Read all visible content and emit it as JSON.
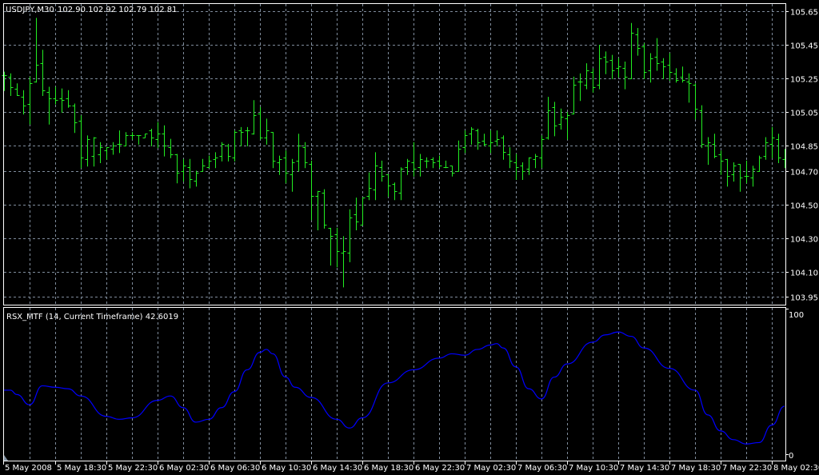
{
  "main_panel": {
    "symbol_label": "USDJPY,M30",
    "ohlc_readout": "102.90 102.92 102.79 102.81",
    "price_axis_labels": [
      "105.65",
      "105.45",
      "105.25",
      "105.05",
      "104.85",
      "104.70",
      "104.50",
      "104.30",
      "104.10",
      "103.95"
    ]
  },
  "indicator_panel": {
    "title": "RSX_MTF (14, Current Timeframe) 42.6019",
    "axis_max_label": "100",
    "axis_min_label": "0"
  },
  "time_axis_labels": [
    "5 May 2008",
    "5 May 18:30",
    "5 May 22:30",
    "6 May 02:30",
    "6 May 06:30",
    "6 May 10:30",
    "6 May 14:30",
    "6 May 18:30",
    "6 May 22:30",
    "7 May 02:30",
    "7 May 06:30",
    "7 May 10:30",
    "7 May 14:30",
    "7 May 18:30",
    "7 May 22:30",
    "8 May 02:30"
  ],
  "colors": {
    "background": "#000000",
    "bars": "#22ee22",
    "grid": "#7f8c9c",
    "rsx_line": "#0000ff",
    "frame": "#ffffff"
  },
  "chart_data": [
    {
      "type": "ohlc",
      "title": "USDJPY,M30",
      "ylim": [
        103.95,
        105.65
      ],
      "price_ticks": [
        105.65,
        105.45,
        105.25,
        105.05,
        104.85,
        104.7,
        104.5,
        104.3,
        104.1,
        103.95
      ],
      "bars_ohlc": [
        [
          105.27,
          105.29,
          105.18,
          105.27
        ],
        [
          105.26,
          105.28,
          105.15,
          105.2
        ],
        [
          105.19,
          105.22,
          105.15,
          105.15
        ],
        [
          105.14,
          105.18,
          105.04,
          105.09
        ],
        [
          105.1,
          105.26,
          104.98,
          105.22
        ],
        [
          105.23,
          105.61,
          105.23,
          105.33
        ],
        [
          105.34,
          105.42,
          105.15,
          105.18
        ],
        [
          105.17,
          105.2,
          104.98,
          105.13
        ],
        [
          105.13,
          105.2,
          105.1,
          105.12
        ],
        [
          105.13,
          105.19,
          105.05,
          105.12
        ],
        [
          105.13,
          105.18,
          105.08,
          105.09
        ],
        [
          105.09,
          105.1,
          104.93,
          104.99
        ],
        [
          105.0,
          105.03,
          104.72,
          104.78
        ],
        [
          104.77,
          104.91,
          104.73,
          104.89
        ],
        [
          104.79,
          104.9,
          104.73,
          104.9
        ],
        [
          104.8,
          104.87,
          104.75,
          104.84
        ],
        [
          104.82,
          104.84,
          104.77,
          104.84
        ],
        [
          104.83,
          104.87,
          104.8,
          104.85
        ],
        [
          104.86,
          104.94,
          104.81,
          104.86
        ],
        [
          104.85,
          104.93,
          104.85,
          104.91
        ],
        [
          104.91,
          104.93,
          104.89,
          104.91
        ],
        [
          104.91,
          104.91,
          104.86,
          104.91
        ],
        [
          104.9,
          104.92,
          104.9,
          104.92
        ],
        [
          104.94,
          104.95,
          104.85,
          104.9
        ],
        [
          104.89,
          104.99,
          104.84,
          104.92
        ],
        [
          104.92,
          104.97,
          104.79,
          104.85
        ],
        [
          104.84,
          104.89,
          104.78,
          104.8
        ],
        [
          104.8,
          104.8,
          104.63,
          104.69
        ],
        [
          104.7,
          104.77,
          104.64,
          104.73
        ],
        [
          104.72,
          104.77,
          104.6,
          104.65
        ],
        [
          104.64,
          104.7,
          104.61,
          104.69
        ],
        [
          104.7,
          104.77,
          104.7,
          104.73
        ],
        [
          104.72,
          104.79,
          104.72,
          104.76
        ],
        [
          104.77,
          104.81,
          104.72,
          104.78
        ],
        [
          104.79,
          104.87,
          104.76,
          104.86
        ],
        [
          104.85,
          104.86,
          104.76,
          104.79
        ],
        [
          104.78,
          104.94,
          104.76,
          104.93
        ],
        [
          104.94,
          104.96,
          104.85,
          104.93
        ],
        [
          104.94,
          104.96,
          104.85,
          104.94
        ],
        [
          104.92,
          105.12,
          104.92,
          105.03
        ],
        [
          105.04,
          105.08,
          104.89,
          104.9
        ],
        [
          104.9,
          105.01,
          104.86,
          104.94
        ],
        [
          104.93,
          104.93,
          104.72,
          104.76
        ],
        [
          104.75,
          104.79,
          104.68,
          104.77
        ],
        [
          104.78,
          104.82,
          104.63,
          104.69
        ],
        [
          104.68,
          104.77,
          104.58,
          104.75
        ],
        [
          104.76,
          104.92,
          104.7,
          104.85
        ],
        [
          104.84,
          104.87,
          104.72,
          104.75
        ],
        [
          104.74,
          104.76,
          104.41,
          104.55
        ],
        [
          104.55,
          104.58,
          104.35,
          104.58
        ],
        [
          104.57,
          104.59,
          104.36,
          104.38
        ],
        [
          104.36,
          104.36,
          104.14,
          104.31
        ],
        [
          104.32,
          104.36,
          104.13,
          104.22
        ],
        [
          104.21,
          104.31,
          104.01,
          104.22
        ],
        [
          104.21,
          104.47,
          104.16,
          104.42
        ],
        [
          104.44,
          104.54,
          104.35,
          104.4
        ],
        [
          104.38,
          104.54,
          104.38,
          104.54
        ],
        [
          104.55,
          104.69,
          104.53,
          104.6
        ],
        [
          104.59,
          104.81,
          104.53,
          104.73
        ],
        [
          104.72,
          104.76,
          104.64,
          104.67
        ],
        [
          104.68,
          104.68,
          104.55,
          104.61
        ],
        [
          104.62,
          104.63,
          104.53,
          104.58
        ],
        [
          104.57,
          104.72,
          104.53,
          104.71
        ],
        [
          104.72,
          104.77,
          104.68,
          104.76
        ],
        [
          104.75,
          104.87,
          104.67,
          104.71
        ],
        [
          104.72,
          104.8,
          104.67,
          104.77
        ],
        [
          104.76,
          104.78,
          104.72,
          104.76
        ],
        [
          104.77,
          104.78,
          104.72,
          104.75
        ],
        [
          104.76,
          104.79,
          104.72,
          104.73
        ],
        [
          104.72,
          104.76,
          104.72,
          104.72
        ],
        [
          104.73,
          104.73,
          104.67,
          104.69
        ],
        [
          104.7,
          104.88,
          104.7,
          104.83
        ],
        [
          104.84,
          104.94,
          104.81,
          104.91
        ],
        [
          104.92,
          104.96,
          104.86,
          104.95
        ],
        [
          104.94,
          104.95,
          104.83,
          104.87
        ],
        [
          104.88,
          104.92,
          104.85,
          104.86
        ],
        [
          104.85,
          104.94,
          104.81,
          104.87
        ],
        [
          104.88,
          104.94,
          104.85,
          104.89
        ],
        [
          104.9,
          104.91,
          104.77,
          104.81
        ],
        [
          104.8,
          104.84,
          104.72,
          104.76
        ],
        [
          104.75,
          104.8,
          104.65,
          104.72
        ],
        [
          104.73,
          104.75,
          104.65,
          104.7
        ],
        [
          104.71,
          104.78,
          104.68,
          104.78
        ],
        [
          104.77,
          104.8,
          104.72,
          104.79
        ],
        [
          104.78,
          104.91,
          104.72,
          104.89
        ],
        [
          104.9,
          105.14,
          104.89,
          105.06
        ],
        [
          105.08,
          105.11,
          104.91,
          104.97
        ],
        [
          104.98,
          105.07,
          104.95,
          105.02
        ],
        [
          105.01,
          105.05,
          104.89,
          105.03
        ],
        [
          105.04,
          105.26,
          105.04,
          105.21
        ],
        [
          105.23,
          105.28,
          105.12,
          105.23
        ],
        [
          105.21,
          105.34,
          105.19,
          105.3
        ],
        [
          105.29,
          105.31,
          105.17,
          105.2
        ],
        [
          105.21,
          105.45,
          105.19,
          105.37
        ],
        [
          105.38,
          105.41,
          105.28,
          105.35
        ],
        [
          105.36,
          105.39,
          105.25,
          105.3
        ],
        [
          105.31,
          105.37,
          105.26,
          105.32
        ],
        [
          105.31,
          105.35,
          105.19,
          105.26
        ],
        [
          105.25,
          105.58,
          105.25,
          105.52
        ],
        [
          105.51,
          105.55,
          105.39,
          105.43
        ],
        [
          105.44,
          105.46,
          105.25,
          105.29
        ],
        [
          105.3,
          105.4,
          105.23,
          105.37
        ],
        [
          105.38,
          105.49,
          105.3,
          105.34
        ],
        [
          105.35,
          105.37,
          105.25,
          105.32
        ],
        [
          105.33,
          105.4,
          105.24,
          105.29
        ],
        [
          105.28,
          105.31,
          105.23,
          105.24
        ],
        [
          105.26,
          105.32,
          105.23,
          105.24
        ],
        [
          105.23,
          105.28,
          105.11,
          105.22
        ],
        [
          105.21,
          105.22,
          105.01,
          105.07
        ],
        [
          105.06,
          105.09,
          104.84,
          104.86
        ],
        [
          104.85,
          104.9,
          104.74,
          104.87
        ],
        [
          104.86,
          104.92,
          104.78,
          104.79
        ],
        [
          104.8,
          104.82,
          104.68,
          104.76
        ],
        [
          104.77,
          104.77,
          104.61,
          104.67
        ],
        [
          104.68,
          104.75,
          104.64,
          104.73
        ],
        [
          104.74,
          104.74,
          104.58,
          104.66
        ],
        [
          104.67,
          104.76,
          104.63,
          104.67
        ],
        [
          104.66,
          104.73,
          104.61,
          104.71
        ],
        [
          104.7,
          104.79,
          104.7,
          104.78
        ],
        [
          104.79,
          104.9,
          104.77,
          104.87
        ],
        [
          104.86,
          104.96,
          104.78,
          104.9
        ],
        [
          104.89,
          104.92,
          104.75,
          104.78
        ],
        [
          104.77,
          104.83,
          104.72,
          104.79
        ]
      ]
    },
    {
      "type": "line",
      "title": "RSX_MTF (14, Current Timeframe) 42.6019",
      "ylim": [
        0,
        100
      ],
      "series": [
        {
          "name": "RSX_MTF",
          "points_bar_index_value": [
            [
              0,
              44
            ],
            [
              1,
              44
            ],
            [
              2,
              41
            ],
            [
              4,
              34
            ],
            [
              6,
              47
            ],
            [
              8,
              46
            ],
            [
              10,
              45
            ],
            [
              12,
              40
            ],
            [
              16,
              26
            ],
            [
              18,
              24
            ],
            [
              20,
              25
            ],
            [
              24,
              37
            ],
            [
              26,
              40
            ],
            [
              28,
              32
            ],
            [
              30,
              22
            ],
            [
              32,
              24
            ],
            [
              34,
              32
            ],
            [
              36,
              43
            ],
            [
              38,
              58
            ],
            [
              40,
              70
            ],
            [
              41,
              72
            ],
            [
              42,
              69
            ],
            [
              44,
              53
            ],
            [
              45.5,
              46
            ],
            [
              48,
              39
            ],
            [
              52,
              24
            ],
            [
              54,
              18
            ],
            [
              56,
              25
            ],
            [
              60,
              49
            ],
            [
              64,
              58
            ],
            [
              68,
              66
            ],
            [
              70,
              69
            ],
            [
              72,
              68
            ],
            [
              74,
              72
            ],
            [
              76,
              75
            ],
            [
              77,
              76
            ],
            [
              78,
              73
            ],
            [
              80,
              60
            ],
            [
              82,
              45
            ],
            [
              84,
              38
            ],
            [
              86,
              53
            ],
            [
              88,
              62
            ],
            [
              92,
              77
            ],
            [
              94,
              82
            ],
            [
              96,
              84
            ],
            [
              98,
              81
            ],
            [
              100,
              73
            ],
            [
              104,
              59
            ],
            [
              108,
              44
            ],
            [
              110,
              27
            ],
            [
              112,
              16
            ],
            [
              114,
              10
            ],
            [
              116,
              7
            ],
            [
              118,
              8
            ],
            [
              120,
              20
            ],
            [
              122,
              33
            ]
          ]
        }
      ]
    }
  ]
}
